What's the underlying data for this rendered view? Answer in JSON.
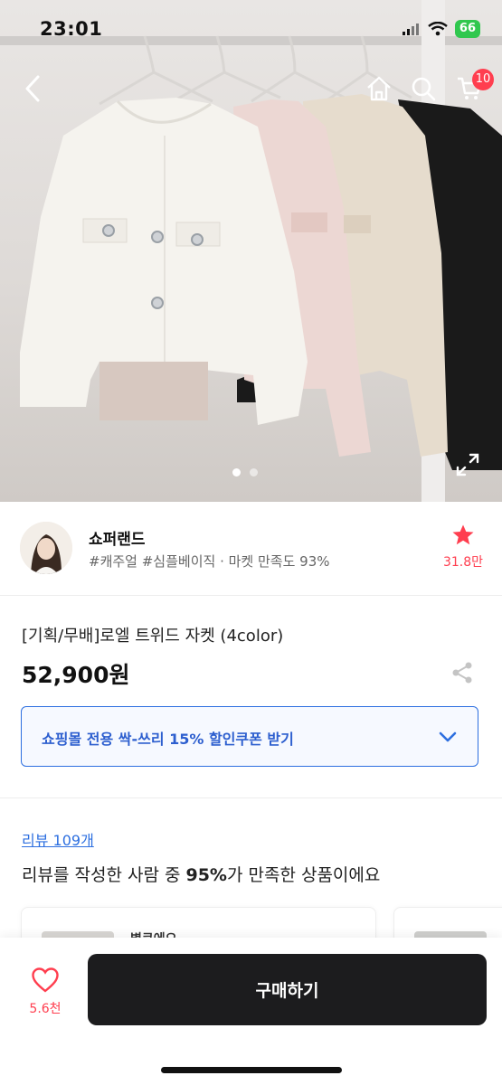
{
  "status_bar": {
    "time": "23:01",
    "battery": "66"
  },
  "header": {
    "cart_badge": "10",
    "icons": [
      "back-icon",
      "home-icon",
      "search-icon",
      "cart-icon"
    ]
  },
  "gallery": {
    "page_count": 2,
    "active_page": 1
  },
  "shop": {
    "name": "쇼퍼랜드",
    "tags": "#캐주얼 #심플베이직 · 마켓 만족도 93%",
    "favorite_count": "31.8만"
  },
  "product": {
    "title": "[기획/무배]로엘 트위드 자켓 (4color)",
    "price": "52,900원"
  },
  "coupon": {
    "label": "쇼핑몰 전용 싹-쓰리 15% 할인쿠폰 받기"
  },
  "reviews": {
    "link_label": "리뷰 109개",
    "summary_prefix": "리뷰를 작성한 사람 중 ",
    "summary_percent": "95%",
    "summary_suffix": "가 만족한 상품이에요",
    "first_reviewer": "별쿠에오"
  },
  "bottom_bar": {
    "like_count": "5.6천",
    "buy_label": "구매하기"
  },
  "colors": {
    "accent_red": "#ff3e4f",
    "accent_blue": "#2d6fe0",
    "buy_button": "#1c1c1e"
  }
}
